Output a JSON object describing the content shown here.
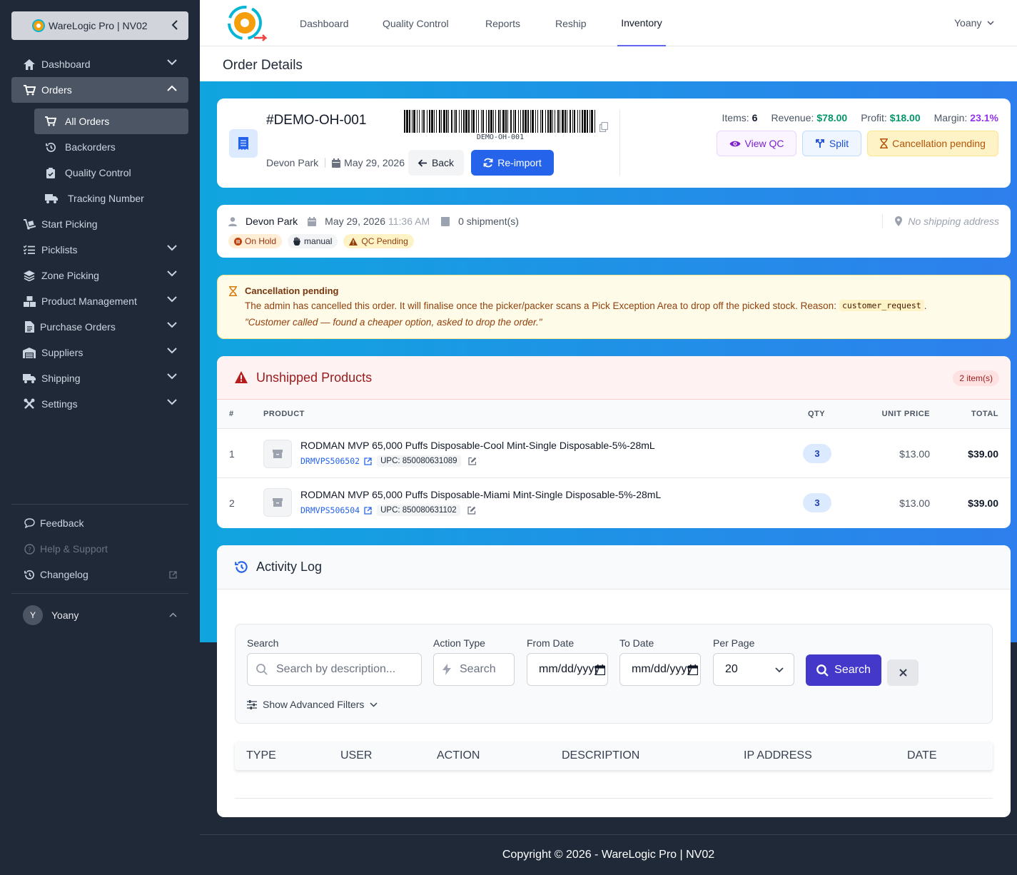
{
  "sidebar": {
    "brand": "WareLogic Pro | NV02",
    "items": [
      {
        "label": "Dashboard",
        "icon": "home-icon"
      },
      {
        "label": "Orders",
        "icon": "cart-icon"
      },
      {
        "label": "Start Picking",
        "icon": "dolly-icon"
      },
      {
        "label": "Picklists",
        "icon": "list-check-icon"
      },
      {
        "label": "Zone Picking",
        "icon": "layers-icon"
      },
      {
        "label": "Product Management",
        "icon": "boxes-icon"
      },
      {
        "label": "Purchase Orders",
        "icon": "file-invoice-icon"
      },
      {
        "label": "Suppliers",
        "icon": "warehouse-icon"
      },
      {
        "label": "Shipping",
        "icon": "truck-icon"
      },
      {
        "label": "Settings",
        "icon": "tools-icon"
      }
    ],
    "orders_sub": [
      "All Orders",
      "Backorders",
      "Quality Control",
      "Tracking Number"
    ],
    "bottom": [
      "Feedback",
      "Help & Support",
      "Changelog"
    ],
    "user": {
      "initial": "Y",
      "name": "Yoany"
    }
  },
  "topnav": {
    "tabs": [
      "Dashboard",
      "Quality Control",
      "Reports",
      "Reship",
      "Inventory"
    ],
    "active": "Inventory",
    "user": "Yoany"
  },
  "page_title": "Order Details",
  "order": {
    "number": "#DEMO-OH-001",
    "barcode_text": "DEMO-OH-001",
    "customer": "Devon Park",
    "date": "May 29, 2026",
    "back": "Back",
    "reimport": "Re-import",
    "stats": {
      "items_label": "Items:",
      "items": "6",
      "revenue_label": "Revenue:",
      "revenue": "$78.00",
      "profit_label": "Profit:",
      "profit": "$18.00",
      "margin_label": "Margin:",
      "margin": "23.1%"
    },
    "view_qc": "View QC",
    "split": "Split",
    "cancel_pending": "Cancellation pending"
  },
  "info": {
    "customer": "Devon Park",
    "date": "May 29, 2026",
    "time": "11:36 AM",
    "shipments": "0 shipment(s)",
    "address": "No shipping address",
    "badges": [
      "On Hold",
      "manual",
      "QC Pending"
    ]
  },
  "alert": {
    "title": "Cancellation pending",
    "text": "The admin has cancelled this order. It will finalise once the picker/packer scans a Pick Exception Area to drop off the picked stock.  Reason:",
    "reason": "customer_request",
    "after": ".",
    "quote": "\"Customer called — found a cheaper option, asked to drop the order.\""
  },
  "unshipped": {
    "title": "Unshipped Products",
    "count": "2 item(s)",
    "headers": [
      "#",
      "PRODUCT",
      "QTY",
      "UNIT PRICE",
      "TOTAL"
    ],
    "rows": [
      {
        "n": "1",
        "name": "RODMAN MVP 65,000 Puffs Disposable-Cool Mint-Single Disposable-5%-28mL",
        "sku": "DRMVPS506502",
        "upc": "UPC: 850080631089",
        "qty": "3",
        "price": "$13.00",
        "total": "$39.00"
      },
      {
        "n": "2",
        "name": "RODMAN MVP 65,000 Puffs Disposable-Miami Mint-Single Disposable-5%-28mL",
        "sku": "DRMVPS506504",
        "upc": "UPC: 850080631102",
        "qty": "3",
        "price": "$13.00",
        "total": "$39.00"
      }
    ]
  },
  "activity": {
    "title": "Activity Log",
    "labels": {
      "search": "Search",
      "action": "Action Type",
      "from": "From Date",
      "to": "To Date",
      "per_page": "Per Page"
    },
    "search_placeholder": "Search by description...",
    "action_placeholder": "Search",
    "date_placeholder": "mm/dd/yyyy",
    "per_page": "20",
    "search_btn": "Search",
    "advanced": "Show Advanced Filters",
    "headers": [
      "TYPE",
      "USER",
      "ACTION",
      "DESCRIPTION",
      "IP ADDRESS",
      "DATE"
    ]
  },
  "footer": "Copyright © 2026 - WareLogic Pro | NV02",
  "colors": {
    "revenue": "#059669",
    "profit": "#059669",
    "margin": "#9333ea",
    "primary": "#2563eb",
    "indigo": "#4338ca",
    "danger": "#b91c1c"
  }
}
